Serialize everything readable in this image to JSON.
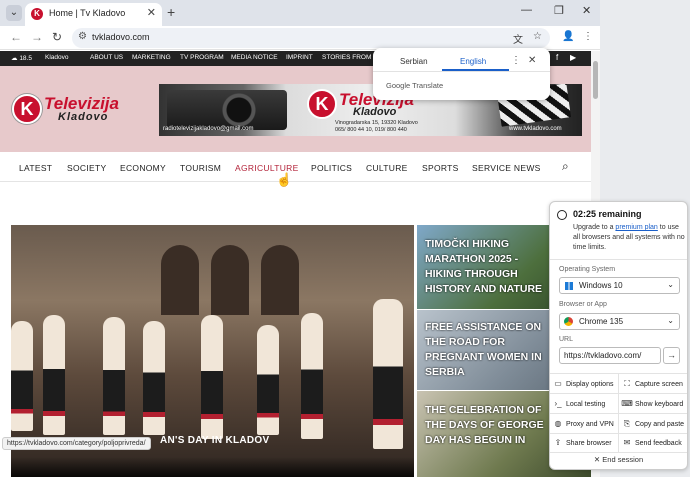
{
  "browser": {
    "tab_title": "Home | Tv Kladovo",
    "favicon_letter": "K",
    "url": "tvkladovo.com",
    "status_url": "https://tvkladovo.com/category/poljoprivreda/"
  },
  "site": {
    "weather_temp": "18.5",
    "weather_city": "Kladovo",
    "top_links": [
      "ABOUT US",
      "MARKETING",
      "TV PROGRAM",
      "MEDIA NOTICE",
      "IMPRINT",
      "STORIES FROM TI"
    ],
    "logo_line1": "Televizija",
    "logo_line2": "Kladovo",
    "banner_address": "Vinogradarska 15, 19320 Kladovo",
    "banner_phone": "065/ 800 44 10, 019/ 800 440",
    "banner_email": "radiotelevizijakladovo@gmail.com",
    "banner_web": "www.tvkladovo.com",
    "nav": [
      "LATEST",
      "SOCIETY",
      "ECONOMY",
      "TOURISM",
      "AGRICULTURE",
      "POLITICS",
      "CULTURE",
      "SPORTS",
      "SERVICE NEWS"
    ],
    "active_nav": "AGRICULTURE",
    "hero_caption": "AN'S DAY IN KLADOV",
    "side_articles": [
      [
        "TIMOČKI HIKING",
        "MARATHON 2025 -",
        "HIKING THROUGH",
        "HISTORY AND NATURE"
      ],
      [
        "FREE ASSISTANCE ON",
        "THE ROAD FOR",
        "PREGNANT WOMEN IN",
        "SERBIA"
      ],
      [
        "THE CELEBRATION OF",
        "THE DAYS OF GEORGE",
        "DAY HAS BEGUN IN"
      ]
    ]
  },
  "translate": {
    "lang_from": "Serbian",
    "lang_to": "English",
    "brand": "Google Translate"
  },
  "panel": {
    "remaining": "02:25 remaining",
    "upgrade_pre": "Upgrade to a ",
    "upgrade_link": "premium plan",
    "upgrade_post": " to use all browsers and all systems with no time limits.",
    "os_label": "Operating System",
    "os_value": "Windows 10",
    "browser_label": "Browser or App",
    "browser_value": "Chrome 135",
    "url_label": "URL",
    "url_value": "https://tvkladovo.com/",
    "buttons": [
      "Display options",
      "Capture screen",
      "Local testing",
      "Show keyboard",
      "Proxy and VPN",
      "Copy and paste",
      "Share browser",
      "Send feedback"
    ],
    "end_session": "End session"
  }
}
